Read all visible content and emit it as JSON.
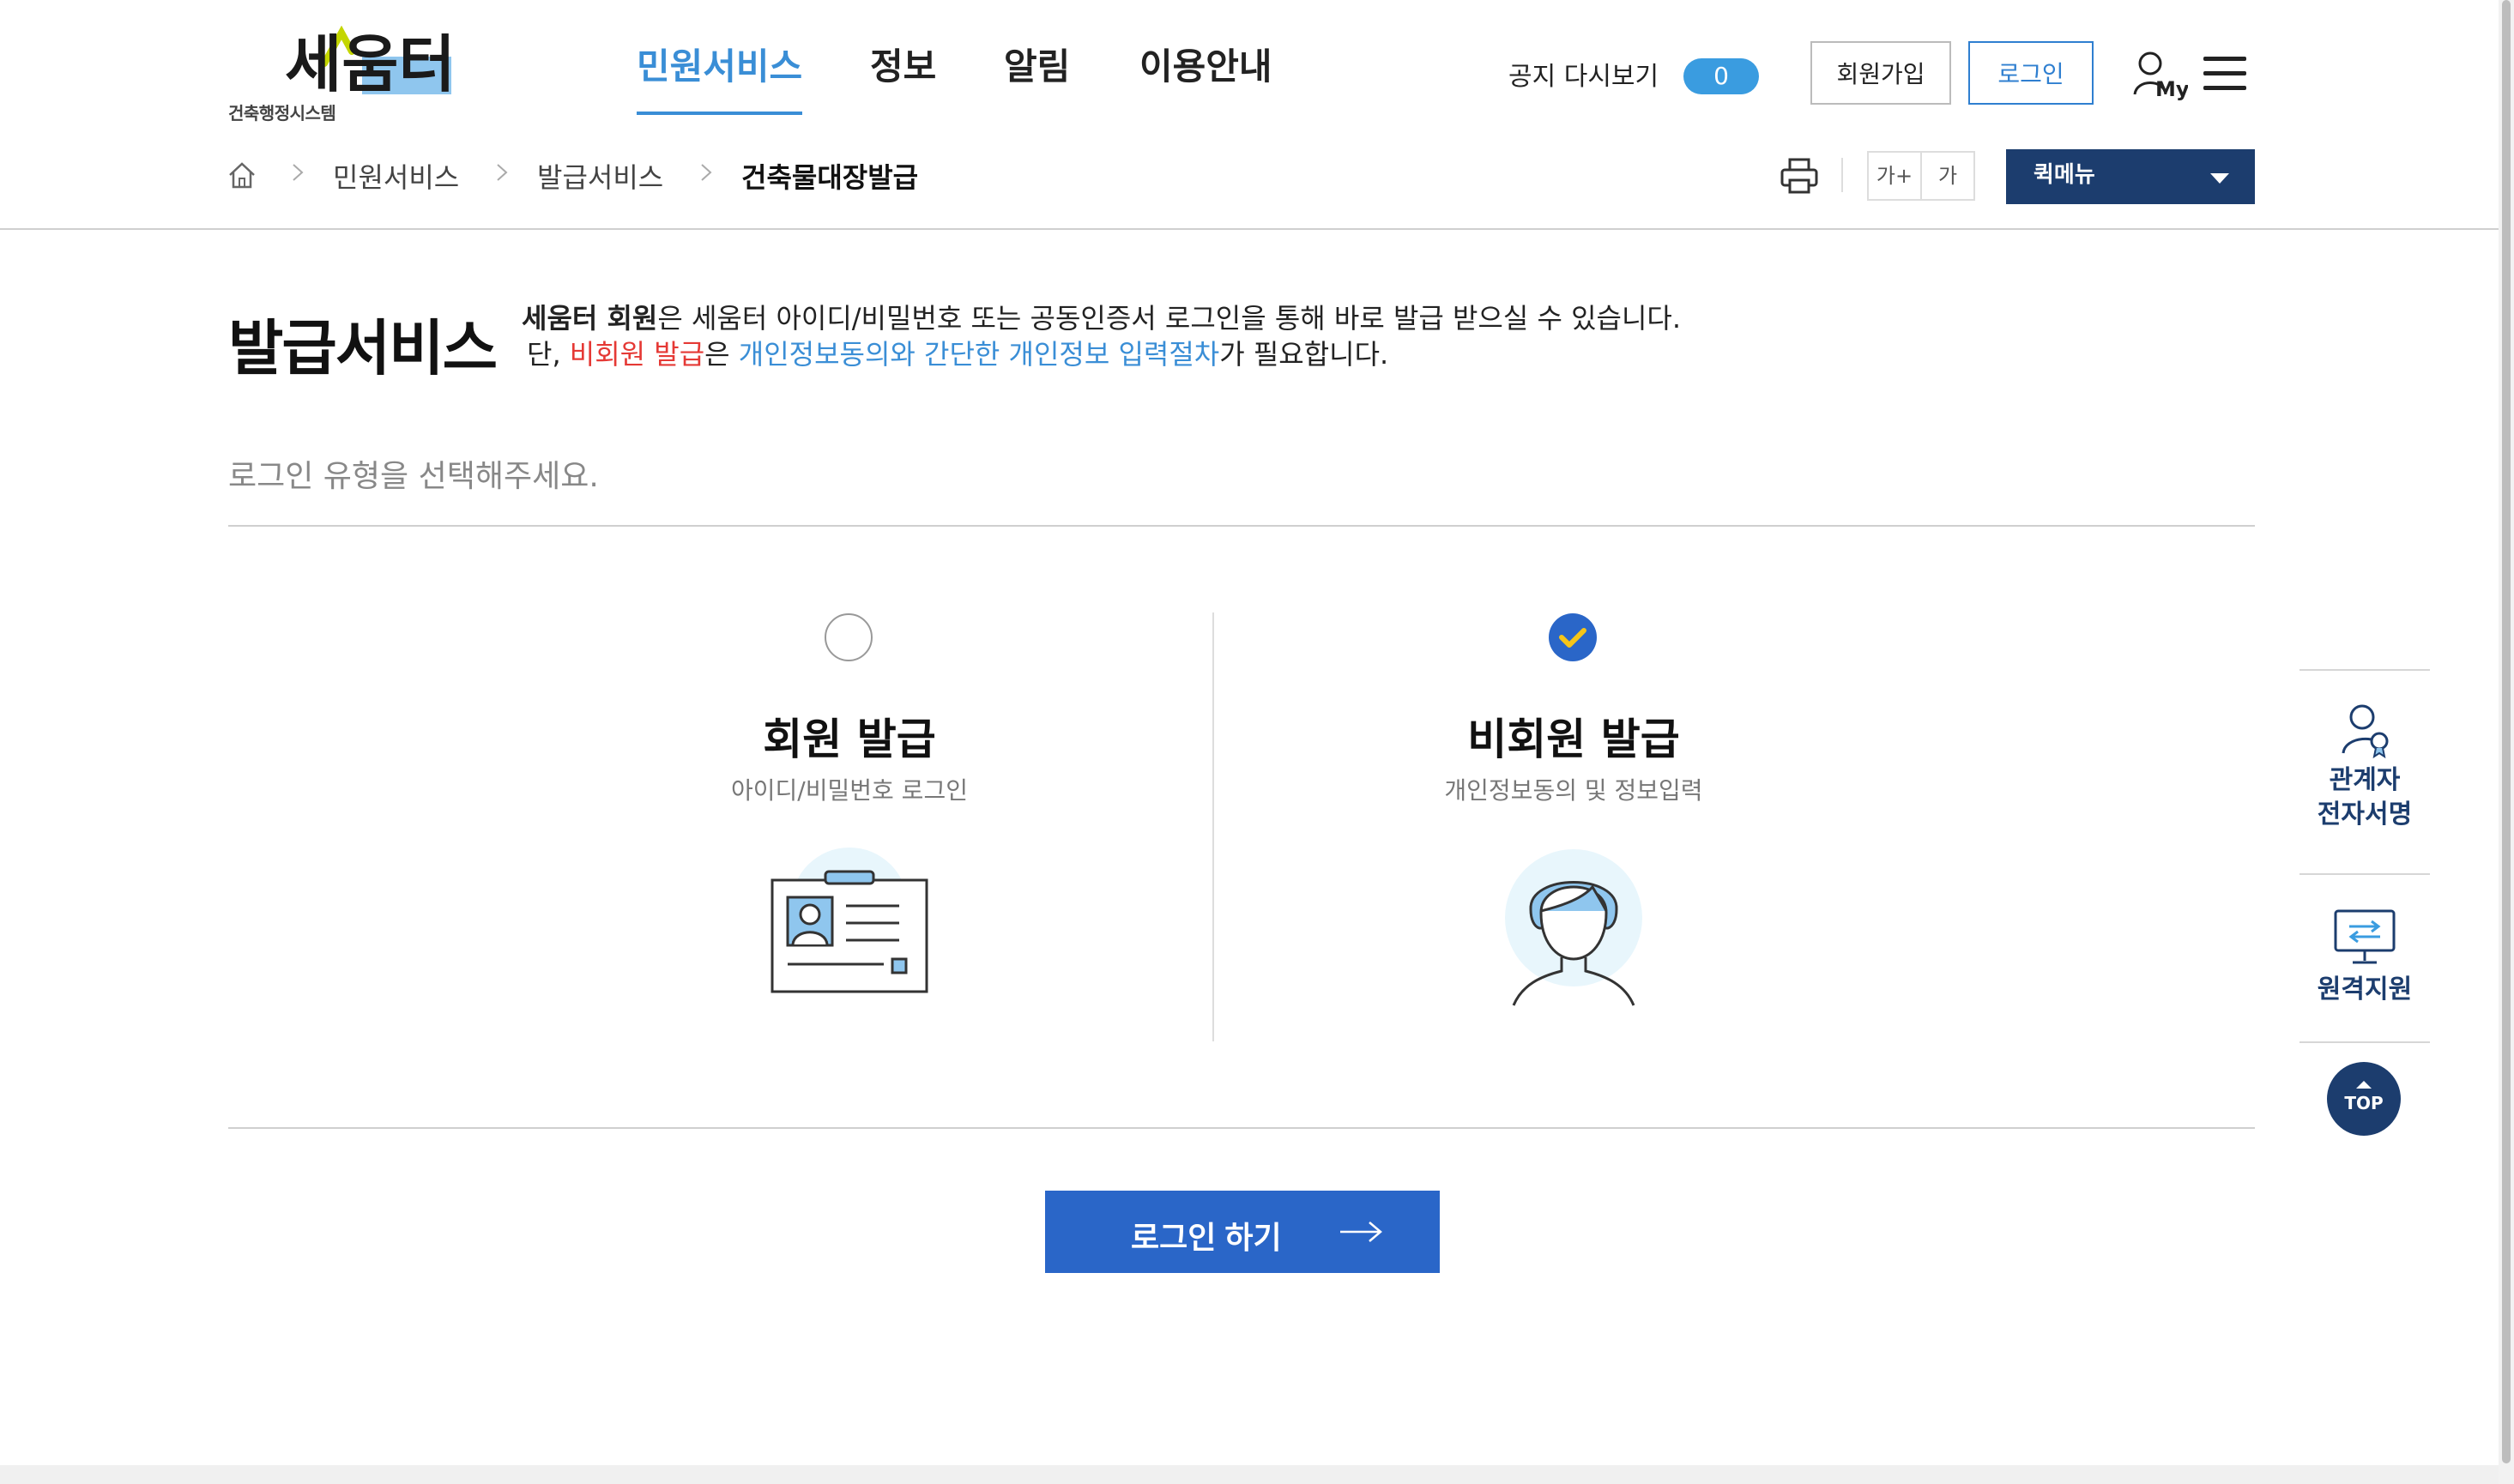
{
  "header": {
    "logo_text": "세움터",
    "logo_sub": "건축행정시스템",
    "gnb": [
      "민원서비스",
      "정보",
      "알림",
      "이용안내"
    ],
    "notice_label": "공지 다시보기",
    "notice_count": "0",
    "signup_label": "회원가입",
    "login_label": "로그인",
    "my_label": "My"
  },
  "breadcrumb": [
    "민원서비스",
    "발급서비스",
    "건축물대장발급"
  ],
  "tools": {
    "font_up": "가+",
    "font_down": "가",
    "quick_menu": "퀵메뉴"
  },
  "main": {
    "title": "발급서비스",
    "desc1_member": "세움터 회원",
    "desc1_rest": "은 세움터 아이디/비밀번호 또는 공동인증서 로그인을 통해 바로 발급 받으실 수 있습니다.",
    "desc2_prefix": "단, ",
    "desc2_red": "비회원 발급",
    "desc2_mid": "은 ",
    "desc2_blue": "개인정보동의와 간단한 개인정보 입력절차",
    "desc2_suffix": "가 필요합니다.",
    "select_label": "로그인 유형을 선택해주세요.",
    "options": [
      {
        "title": "회원 발급",
        "sub": "아이디/비밀번호 로그인",
        "selected": false
      },
      {
        "title": "비회원 발급",
        "sub": "개인정보동의 및 정보입력",
        "selected": true
      }
    ],
    "login_button": "로그인 하기"
  },
  "quick_panel": {
    "item1_line1": "관계자",
    "item1_line2": "전자서명",
    "item2": "원격지원",
    "top": "TOP"
  },
  "colors": {
    "accent": "#3a8ed6",
    "navy": "#1c3d6e",
    "button": "#2a66c8",
    "red": "#e53935"
  }
}
